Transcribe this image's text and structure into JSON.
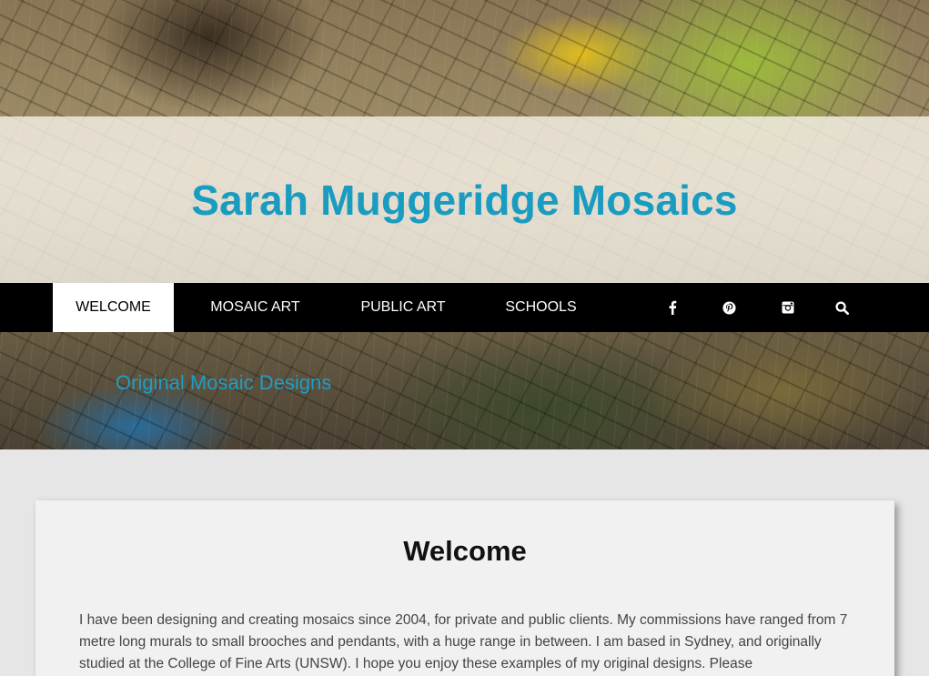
{
  "site": {
    "title": "Sarah Muggeridge Mosaics",
    "tagline": "Original Mosaic Designs"
  },
  "nav": {
    "items": [
      {
        "label": "WELCOME",
        "active": true
      },
      {
        "label": "MOSAIC ART",
        "active": false
      },
      {
        "label": "PUBLIC ART",
        "active": false
      },
      {
        "label": "SCHOOLS",
        "active": false
      }
    ],
    "icons": [
      "facebook-icon",
      "pinterest-icon",
      "instagram-icon",
      "search-icon"
    ]
  },
  "content": {
    "heading": "Welcome",
    "body": "I have been designing and creating mosaics since 2004, for private and public clients. My commissions have ranged from 7 metre long murals to small brooches and pendants, with a huge range in between. I am based in Sydney, and originally studied at the College of Fine Arts (UNSW). I hope you enjoy these examples of my original designs. Please"
  },
  "colors": {
    "accent": "#1a9cc1",
    "nav_bg": "#000000",
    "page_bg": "#e6e6e6"
  }
}
